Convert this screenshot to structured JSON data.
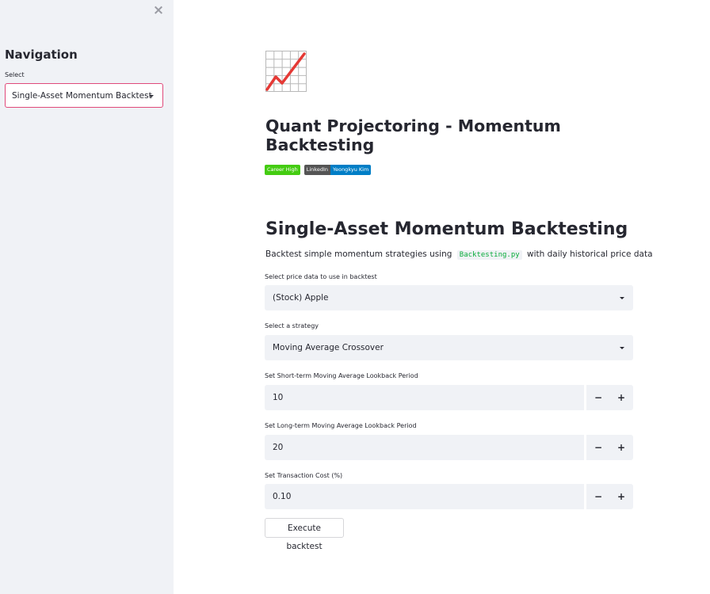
{
  "sidebar": {
    "close_icon": "close-icon",
    "title": "Navigation",
    "select_label": "Select",
    "select_value": "Single-Asset Momentum Backtest"
  },
  "header": {
    "emoji_icon": "chart-increasing-icon",
    "title": "Quant Projectoring - Momentum Backtesting",
    "badges": [
      {
        "left": "Career High",
        "color_left": "#44cc11"
      },
      {
        "left": "LinkedIn",
        "right": "Yeongkyu Kim",
        "color_left": "#555555",
        "color_right": "#007ec6"
      }
    ]
  },
  "main": {
    "section_title": "Single-Asset Momentum Backtesting",
    "description_pre": "Backtest simple momentum strategies using",
    "description_code": "Backtesting.py",
    "description_post": "with daily historical price data",
    "price_label": "Select price data to use in backtest",
    "price_value": "(Stock) Apple",
    "strategy_label": "Select a strategy",
    "strategy_value": "Moving Average Crossover",
    "short_label": "Set Short-term Moving Average Lookback Period",
    "short_value": "10",
    "long_label": "Set Long-term Moving Average Lookback Period",
    "long_value": "20",
    "cost_label": "Set Transaction Cost (%)",
    "cost_value": "0.10",
    "minus": "−",
    "plus": "+",
    "execute_label": "Execute backtest"
  },
  "colors": {
    "sidebar_bg": "#f0f2f6",
    "accent_border": "#e0497a",
    "code_text": "#09ab3b"
  }
}
